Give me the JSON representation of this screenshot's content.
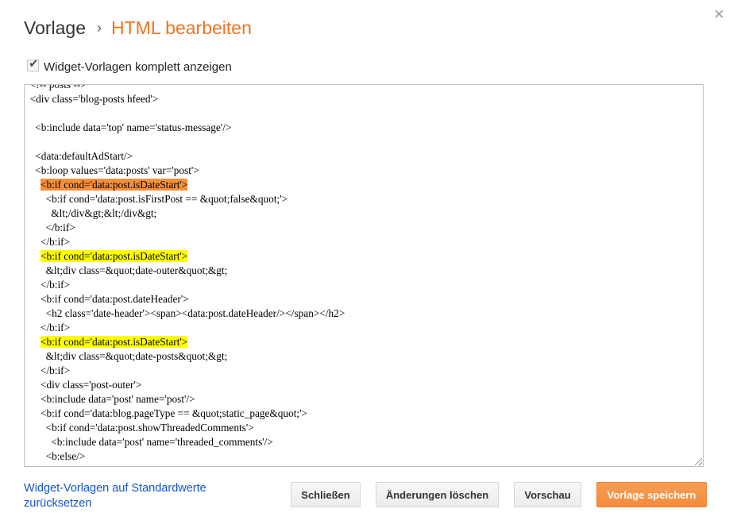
{
  "header": {
    "breadcrumb_root": "Vorlage",
    "breadcrumb_sep": "›",
    "breadcrumb_current": "HTML bearbeiten",
    "close_glyph": "×"
  },
  "options": {
    "show_widget_templates_label": "Widget-Vorlagen komplett anzeigen",
    "show_widget_templates_checked": true,
    "check_glyph": "✔"
  },
  "editor": {
    "lines": [
      {
        "text": "  <!-- posts -->",
        "hl": ""
      },
      {
        "text": "  <div class='blog-posts hfeed'>",
        "hl": ""
      },
      {
        "text": "",
        "hl": ""
      },
      {
        "text": "    <b:include data='top' name='status-message'/>",
        "hl": ""
      },
      {
        "text": "",
        "hl": ""
      },
      {
        "text": "    <data:defaultAdStart/>",
        "hl": ""
      },
      {
        "text": "    <b:loop values='data:posts' var='post'>",
        "hl": ""
      },
      {
        "text": "      <b:if cond='data:post.isDateStart'>",
        "hl": "orange"
      },
      {
        "text": "        <b:if cond='data:post.isFirstPost == &quot;false&quot;'>",
        "hl": ""
      },
      {
        "text": "          &lt;/div&gt;&lt;/div&gt;",
        "hl": ""
      },
      {
        "text": "        </b:if>",
        "hl": ""
      },
      {
        "text": "      </b:if>",
        "hl": ""
      },
      {
        "text": "      <b:if cond='data:post.isDateStart'>",
        "hl": "yellow"
      },
      {
        "text": "        &lt;div class=&quot;date-outer&quot;&gt;",
        "hl": ""
      },
      {
        "text": "      </b:if>",
        "hl": ""
      },
      {
        "text": "      <b:if cond='data:post.dateHeader'>",
        "hl": ""
      },
      {
        "text": "        <h2 class='date-header'><span><data:post.dateHeader/></span></h2>",
        "hl": ""
      },
      {
        "text": "      </b:if>",
        "hl": ""
      },
      {
        "text": "      <b:if cond='data:post.isDateStart'>",
        "hl": "yellow"
      },
      {
        "text": "        &lt;div class=&quot;date-posts&quot;&gt;",
        "hl": ""
      },
      {
        "text": "      </b:if>",
        "hl": ""
      },
      {
        "text": "      <div class='post-outer'>",
        "hl": ""
      },
      {
        "text": "      <b:include data='post' name='post'/>",
        "hl": ""
      },
      {
        "text": "      <b:if cond='data:blog.pageType == &quot;static_page&quot;'>",
        "hl": ""
      },
      {
        "text": "        <b:if cond='data:post.showThreadedComments'>",
        "hl": ""
      },
      {
        "text": "          <b:include data='post' name='threaded_comments'/>",
        "hl": ""
      },
      {
        "text": "        <b:else/>",
        "hl": ""
      }
    ]
  },
  "footer": {
    "reset_link": "Widget-Vorlagen auf Standardwerte zurücksetzen",
    "close_button": "Schließen",
    "discard_button": "Änderungen löschen",
    "preview_button": "Vorschau",
    "save_button": "Vorlage speichern"
  },
  "colors": {
    "accent_orange": "#f0731e",
    "highlight_current": "#f68f3a",
    "highlight_match": "#ffff00",
    "link_blue": "#1155cc"
  }
}
